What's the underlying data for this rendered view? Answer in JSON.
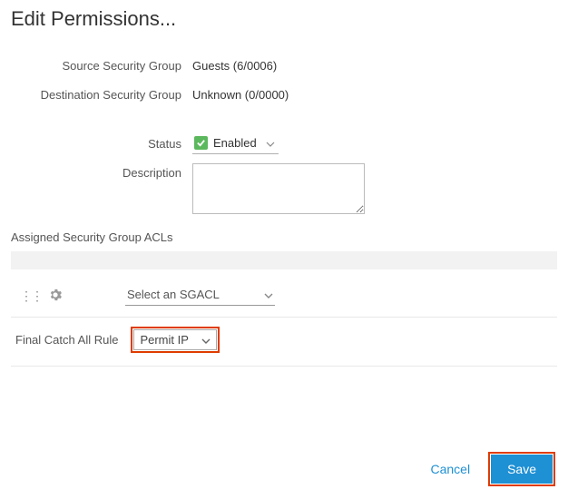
{
  "title": "Edit Permissions...",
  "fields": {
    "sourceGroup": {
      "label": "Source Security Group",
      "value": "Guests (6/0006)"
    },
    "destGroup": {
      "label": "Destination Security Group",
      "value": "Unknown (0/0000)"
    },
    "status": {
      "label": "Status",
      "value": "Enabled"
    },
    "description": {
      "label": "Description",
      "value": ""
    }
  },
  "aclSection": {
    "header": "Assigned Security Group ACLs",
    "selectPlaceholder": "Select an SGACL"
  },
  "catchAll": {
    "label": "Final Catch All Rule",
    "value": "Permit IP"
  },
  "footer": {
    "cancel": "Cancel",
    "save": "Save"
  }
}
